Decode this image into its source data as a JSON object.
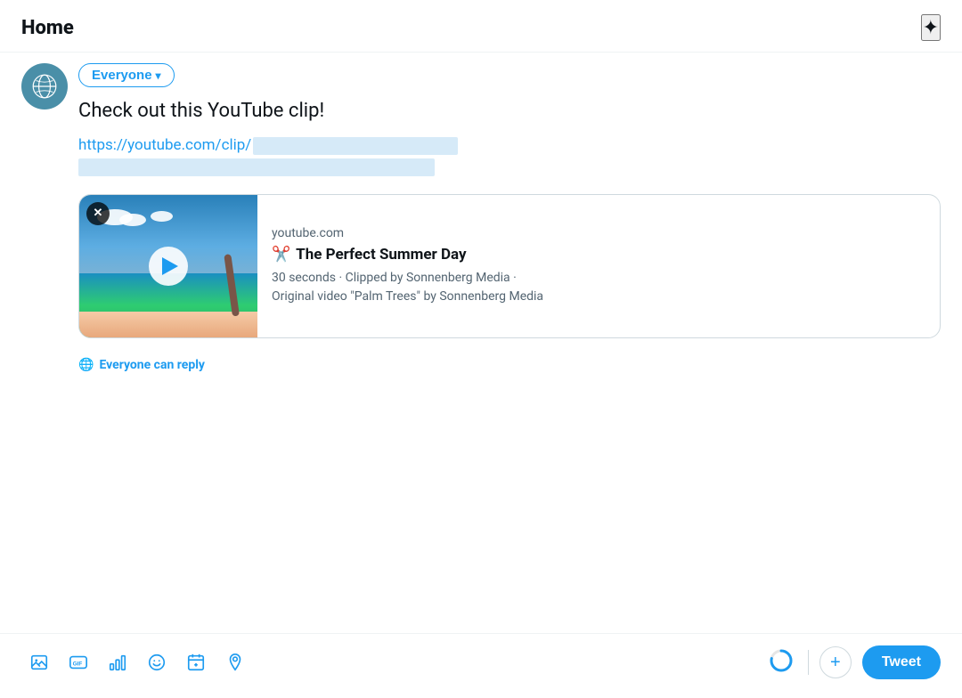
{
  "header": {
    "title": "Home",
    "sparkle_label": "Sparkle / For You"
  },
  "compose": {
    "audience_btn_label": "Everyone",
    "tweet_text": "Check out this YouTube clip!",
    "url_prefix": "https://youtube.com/clip/",
    "reply_setting": "Everyone can reply",
    "toolbar": {
      "image_btn": "Add image",
      "gif_btn": "Add GIF",
      "poll_btn": "Add poll",
      "emoji_btn": "Add emoji",
      "schedule_btn": "Schedule",
      "location_btn": "Add location",
      "tweet_btn_label": "Tweet",
      "add_btn_label": "+"
    },
    "preview": {
      "source": "youtube.com",
      "title": "The Perfect Summer Day",
      "meta_line1": "30 seconds · Clipped by Sonnenberg Media ·",
      "meta_line2": "Original video \"Palm Trees\" by Sonnenberg Media"
    }
  }
}
